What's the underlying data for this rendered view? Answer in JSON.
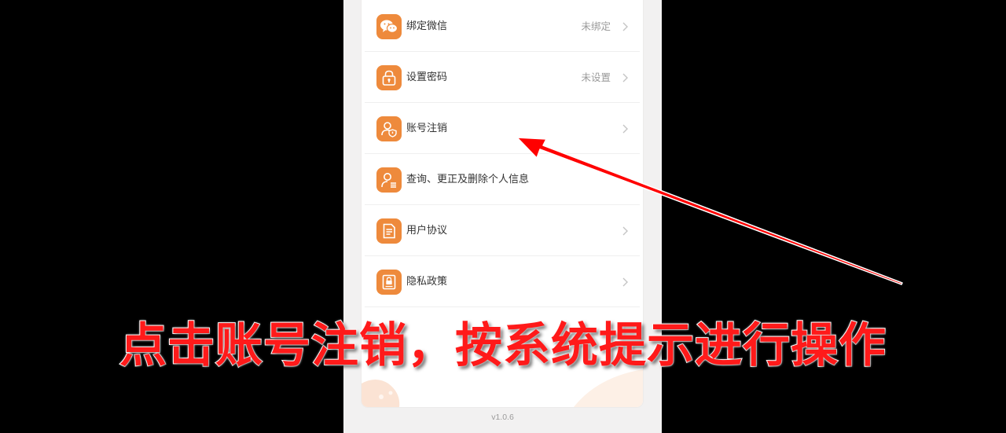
{
  "settings_menu": {
    "items": [
      {
        "label": "绑定微信",
        "value": "未绑定",
        "icon": "wechat-icon"
      },
      {
        "label": "设置密码",
        "value": "未设置",
        "icon": "lock-icon"
      },
      {
        "label": "账号注销",
        "value": "",
        "icon": "user-shield-icon"
      },
      {
        "label": "查询、更正及删除个人信息",
        "value": "",
        "icon": "user-list-icon"
      },
      {
        "label": "用户协议",
        "value": "",
        "icon": "document-icon"
      },
      {
        "label": "隐私政策",
        "value": "",
        "icon": "lock-document-icon"
      }
    ]
  },
  "footer": {
    "version": "v1.0.6"
  },
  "overlay": {
    "caption": "点击账号注销，按系统提示进行操作",
    "arrow_color": "#ff0000"
  },
  "colors": {
    "accent": "#ee8a3c",
    "background": "#000000"
  }
}
